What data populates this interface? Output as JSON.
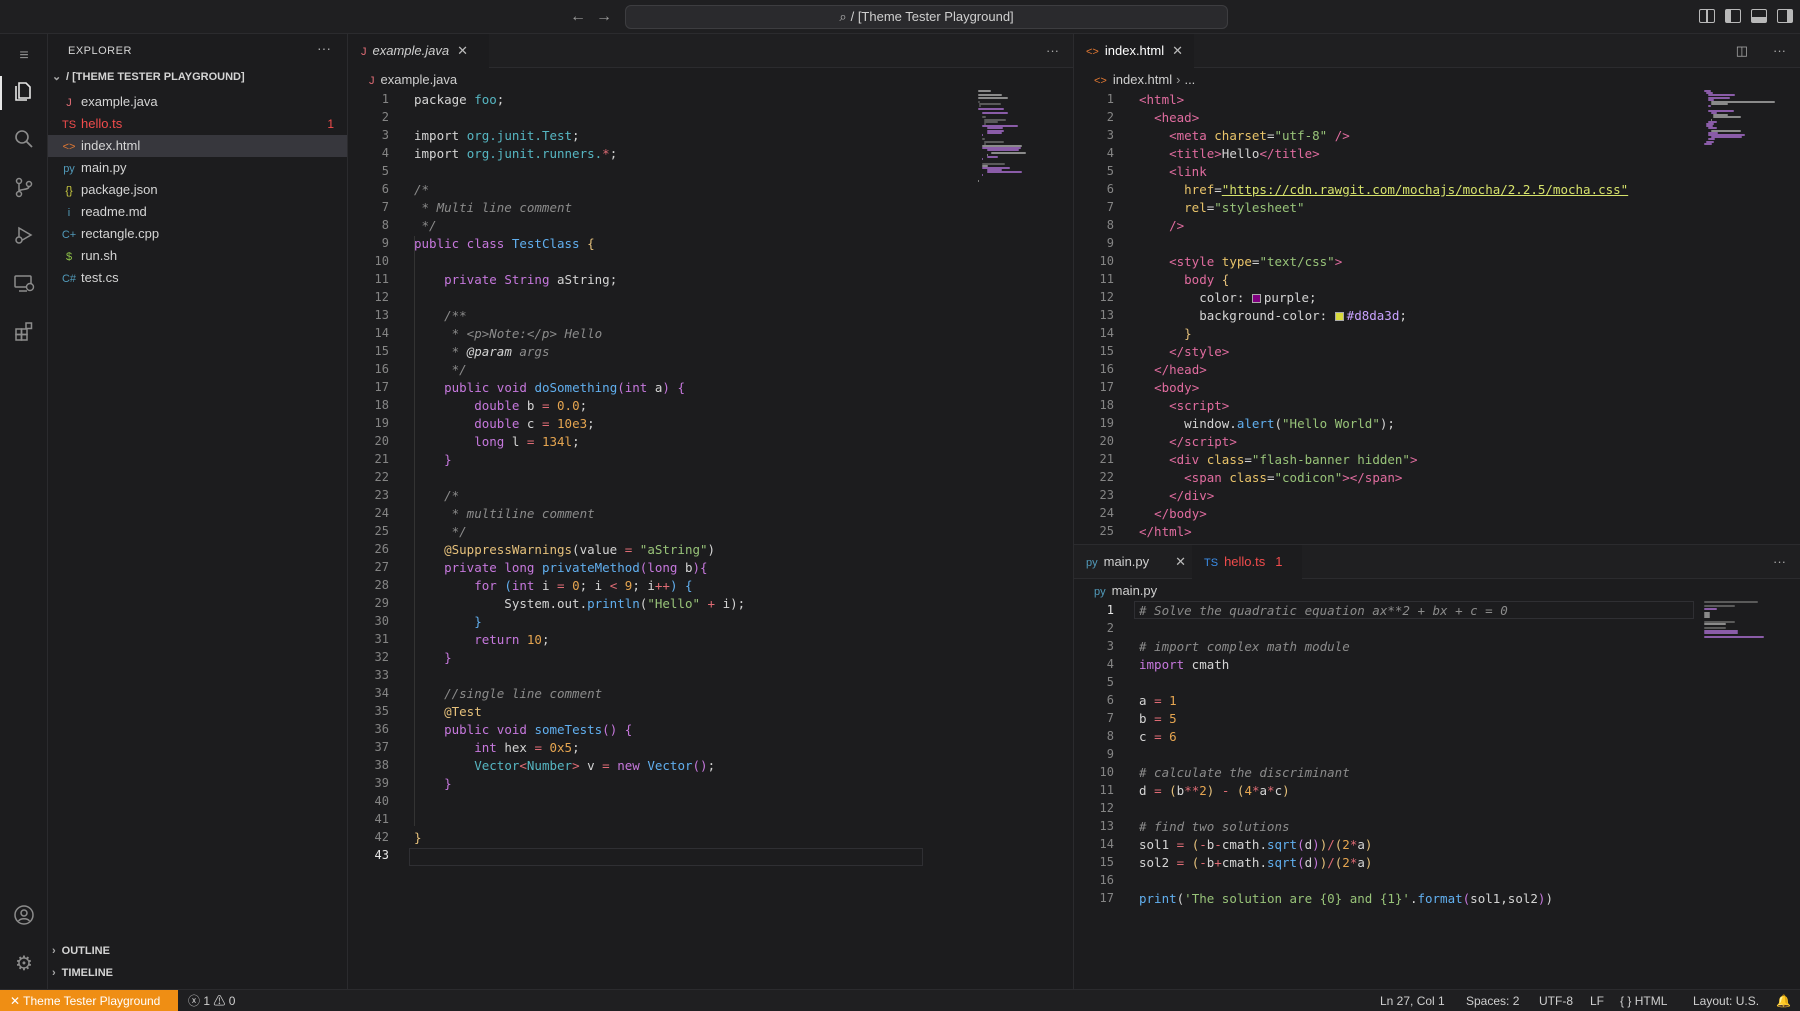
{
  "titlebar": {
    "search_text": "/ [Theme Tester Playground]"
  },
  "sidebar": {
    "title": "EXPLORER",
    "folder": "/ [THEME TESTER PLAYGROUND]",
    "files": [
      {
        "name": "example.java",
        "icon": "J",
        "color": "#e06c75"
      },
      {
        "name": "hello.ts",
        "icon": "TS",
        "color": "#f14c4c",
        "badge": "1"
      },
      {
        "name": "index.html",
        "icon": "<>",
        "color": "#e37933"
      },
      {
        "name": "main.py",
        "icon": "py",
        "color": "#519aba"
      },
      {
        "name": "package.json",
        "icon": "{}",
        "color": "#cbcb41"
      },
      {
        "name": "readme.md",
        "icon": "i",
        "color": "#519aba"
      },
      {
        "name": "rectangle.cpp",
        "icon": "C+",
        "color": "#519aba"
      },
      {
        "name": "run.sh",
        "icon": "$",
        "color": "#8dc149"
      },
      {
        "name": "test.cs",
        "icon": "C#",
        "color": "#519aba"
      }
    ],
    "outline": "OUTLINE",
    "timeline": "TIMELINE"
  },
  "left_group": {
    "tab": "example.java",
    "crumb": "example.java",
    "line_count": 43
  },
  "right_top": {
    "tab": "index.html",
    "crumb": "index.html",
    "crumb_more": "...",
    "line_count": 25
  },
  "right_bottom": {
    "tab1": "main.py",
    "tab2": "hello.ts",
    "tab2_badge": "1",
    "crumb": "main.py",
    "line_count": 17
  },
  "statusbar": {
    "remote": "Theme Tester Playground",
    "errors": "1",
    "warnings": "0",
    "position": "Ln 27, Col 1",
    "spaces": "Spaces: 2",
    "encoding": "UTF-8",
    "eol": "LF",
    "language": "HTML",
    "layout": "Layout: U.S."
  },
  "colors": {
    "accent": "#ef8e14",
    "background": "#1c1c1e",
    "selection": "#37373d"
  }
}
